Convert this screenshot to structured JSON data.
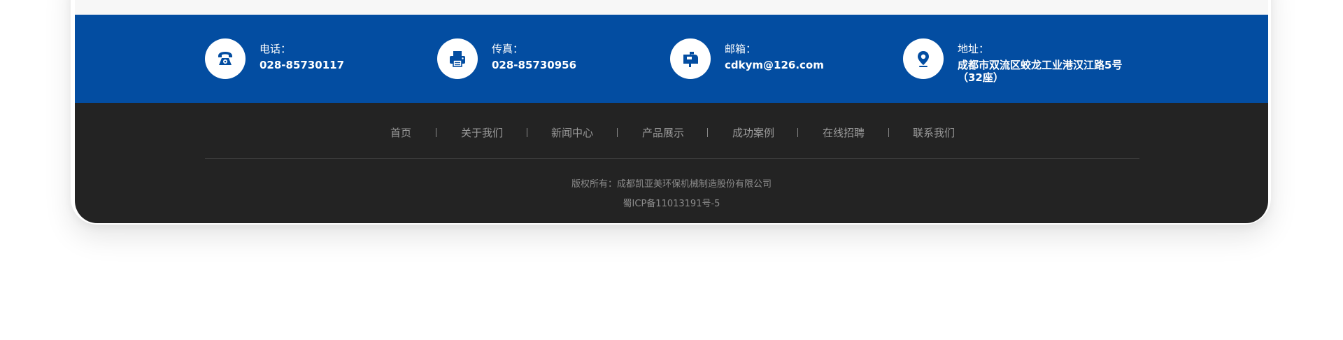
{
  "contacts": [
    {
      "icon": "phone-icon",
      "label": "电话：",
      "value": "028-85730117"
    },
    {
      "icon": "fax-icon",
      "label": "传真：",
      "value": "028-85730956"
    },
    {
      "icon": "mailbox-icon",
      "label": "邮箱：",
      "value": "cdkym@126.com"
    },
    {
      "icon": "location-pin-icon",
      "label": "地址：",
      "value_line1": "成都市双流区蛟龙工业港汉江路5号",
      "value_line2": "（32座）"
    }
  ],
  "nav": [
    "首页",
    "关于我们",
    "新闻中心",
    "产品展示",
    "成功案例",
    "在线招聘",
    "联系我们"
  ],
  "footer": {
    "copyright": "版权所有：成都凯亚美环保机械制造股份有限公司",
    "icp": "蜀ICP备11013191号-5"
  },
  "colors": {
    "contact_bar": "#034da1",
    "footer_bg": "#232323",
    "icon_color": "#034da1"
  }
}
